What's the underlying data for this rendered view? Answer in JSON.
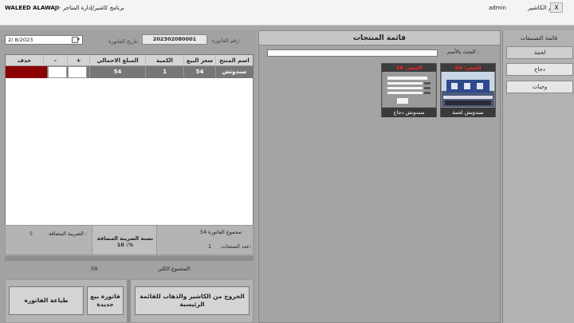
{
  "titlebar": {
    "app_name": "WALEED ALAWAJI",
    "app_subtitle": "- برنامج كاشير/إدارة المتاجر",
    "cashier_label": "اسم الكاشير",
    "cashier_value": "admin",
    "close_label": "X"
  },
  "categories": {
    "title": "قائمة التصنيفات",
    "items": [
      {
        "label": "لحمة"
      },
      {
        "label": "دجاج"
      },
      {
        "label": "وجبات"
      }
    ]
  },
  "products": {
    "title": "قائمة المنتجات",
    "search_label": "البحث بالأسم :",
    "search_value": "",
    "items": [
      {
        "price": "السعر: 54",
        "name": "سندوتش لحمة"
      },
      {
        "price": "السعر: 36",
        "name": "سندوتش دجاج"
      }
    ]
  },
  "invoice": {
    "date_label": "تاريخ الفاتورة:",
    "date_value": "2/  8/2023",
    "number_label": "رقم الفاتورة:",
    "number_value": "202302080001"
  },
  "grid": {
    "headers": [
      "اسم المنتج",
      "سعر البيع",
      "الكمية",
      "المبلغ الاجمالي",
      "+",
      "-",
      "حذف"
    ],
    "rows": [
      {
        "product": "سندوتش لح...",
        "price": "54",
        "qty": "1",
        "total": "54"
      }
    ]
  },
  "totals": {
    "invoice_total_label": "مجموع الفاتورة:",
    "invoice_total_value": "54",
    "products_count_label": "عدد المنتجات:",
    "products_count_value": "1",
    "tax_rate_label": "نسبة الضريبة المضافة : 10%",
    "tax_added_label": "الضريبة المضافة :",
    "tax_added_value": "5",
    "grand_total_label": "المجموع الكلي:",
    "grand_total_value": "59"
  },
  "actions": {
    "exit_label": "الخروج من الكاشير والذهاب للقائمة الرئيسية",
    "new_invoice_label": "فاتورة بيع جديدة",
    "print_label": "طباعة الفاتورة"
  },
  "colors": {
    "delete_cell": "#8b0000",
    "price_text": "#ff2020",
    "background": "#a8a8a8"
  }
}
